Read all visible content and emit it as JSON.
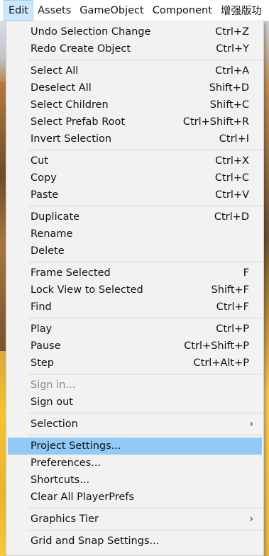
{
  "menubar": {
    "items": [
      "Edit",
      "Assets",
      "GameObject",
      "Component",
      "增强版功"
    ]
  },
  "menu": {
    "groups": [
      [
        {
          "label": "Undo Selection Change",
          "shortcut": "Ctrl+Z"
        },
        {
          "label": "Redo Create Object",
          "shortcut": "Ctrl+Y"
        }
      ],
      [
        {
          "label": "Select All",
          "shortcut": "Ctrl+A"
        },
        {
          "label": "Deselect All",
          "shortcut": "Shift+D"
        },
        {
          "label": "Select Children",
          "shortcut": "Shift+C"
        },
        {
          "label": "Select Prefab Root",
          "shortcut": "Ctrl+Shift+R"
        },
        {
          "label": "Invert Selection",
          "shortcut": "Ctrl+I"
        }
      ],
      [
        {
          "label": "Cut",
          "shortcut": "Ctrl+X"
        },
        {
          "label": "Copy",
          "shortcut": "Ctrl+C"
        },
        {
          "label": "Paste",
          "shortcut": "Ctrl+V"
        }
      ],
      [
        {
          "label": "Duplicate",
          "shortcut": "Ctrl+D"
        },
        {
          "label": "Rename",
          "shortcut": ""
        },
        {
          "label": "Delete",
          "shortcut": ""
        }
      ],
      [
        {
          "label": "Frame Selected",
          "shortcut": "F"
        },
        {
          "label": "Lock View to Selected",
          "shortcut": "Shift+F"
        },
        {
          "label": "Find",
          "shortcut": "Ctrl+F"
        }
      ],
      [
        {
          "label": "Play",
          "shortcut": "Ctrl+P"
        },
        {
          "label": "Pause",
          "shortcut": "Ctrl+Shift+P"
        },
        {
          "label": "Step",
          "shortcut": "Ctrl+Alt+P"
        }
      ],
      [
        {
          "label": "Sign in...",
          "shortcut": "",
          "disabled": true
        },
        {
          "label": "Sign out",
          "shortcut": ""
        }
      ],
      [
        {
          "label": "Selection",
          "shortcut": "",
          "submenu": true
        }
      ],
      [
        {
          "label": "Project Settings...",
          "shortcut": "",
          "highlighted": true
        },
        {
          "label": "Preferences...",
          "shortcut": ""
        },
        {
          "label": "Shortcuts...",
          "shortcut": ""
        },
        {
          "label": "Clear All PlayerPrefs",
          "shortcut": ""
        }
      ],
      [
        {
          "label": "Graphics Tier",
          "shortcut": "",
          "submenu": true
        }
      ],
      [
        {
          "label": "Grid and Snap Settings...",
          "shortcut": ""
        }
      ]
    ]
  },
  "icons": {
    "submenu_arrow": "chevron-right-icon"
  },
  "colors": {
    "highlight": "#91c9f7",
    "menubar_active": "#cce8ff",
    "menu_bg": "#f2f2f2"
  }
}
